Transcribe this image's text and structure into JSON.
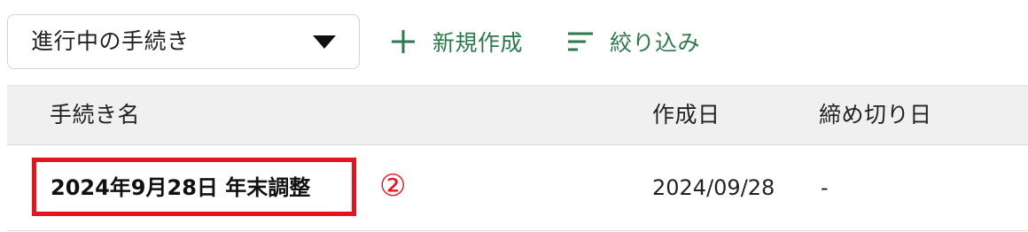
{
  "toolbar": {
    "status_select": {
      "value": "進行中の手続き",
      "icon": "triangle-down-icon"
    },
    "new_button": {
      "label": "新規作成",
      "icon": "plus-icon"
    },
    "filter_button": {
      "label": "絞り込み",
      "icon": "filter-lines-icon"
    },
    "accent_color": "#2b7a4b"
  },
  "table": {
    "headers": {
      "name": "手続き名",
      "created": "作成日",
      "deadline": "締め切り日"
    },
    "rows": [
      {
        "name": "2024年9月28日 年末調整",
        "created": "2024/09/28",
        "deadline": "-"
      }
    ]
  },
  "annotation": {
    "marker": "②",
    "color": "#e8131c"
  }
}
